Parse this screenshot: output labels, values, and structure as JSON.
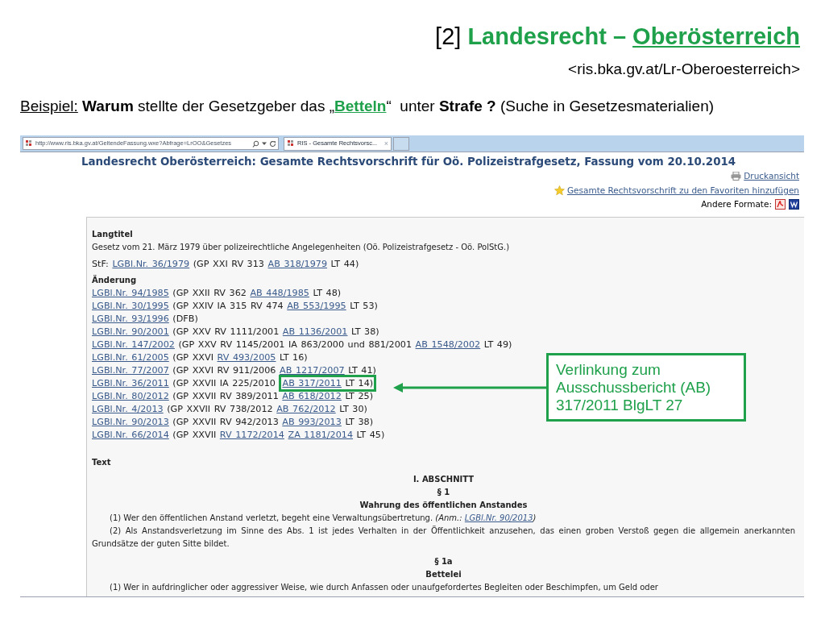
{
  "slide": {
    "heading": [
      {
        "text": "[2] ",
        "kind": "plain"
      },
      {
        "text": "Landesrecht – ",
        "kind": "accent"
      },
      {
        "text": "Oberösterreich",
        "kind": "accent_underline"
      }
    ],
    "subtitle": "<ris.bka.gv.at/Lr-Oberoesterreich>",
    "example": [
      {
        "text": "Beispiel:",
        "kind": "underline"
      },
      {
        "text": " Warum",
        "kind": "bold"
      },
      {
        "text": " stellte der Gesetzgeber das „",
        "kind": "plain"
      },
      {
        "text": "Betteln",
        "kind": "accent_underline"
      },
      {
        "text": "“  unter ",
        "kind": "plain"
      },
      {
        "text": "Strafe ?",
        "kind": "bold"
      },
      {
        "text": " (Suche in Gesetzesmaterialien)",
        "kind": "plain"
      }
    ]
  },
  "browser": {
    "address": "http://www.ris.bka.gv.at/GeltendeFassung.wxe?Abfrage=LrOO&Gesetzes",
    "tab": {
      "title": "RIS - Gesamte Rechtsvorsc...",
      "close": "×"
    }
  },
  "page": {
    "title": "Landesrecht Oberösterreich: Gesamte Rechtsvorschrift für Oö. Polizeistrafgesetz, Fassung vom 20.10.2014",
    "links": [
      {
        "kind": "print",
        "text": "Druckansicht"
      },
      {
        "kind": "favorite",
        "text": "Gesamte Rechtsvorschrift zu den Favoriten hinzufügen"
      }
    ],
    "formats": {
      "label": "Andere Formate:",
      "items": [
        {
          "kind": "pdf"
        },
        {
          "kind": "word"
        }
      ]
    },
    "document": {
      "langtitel": {
        "heading": "Langtitel",
        "text": "Gesetz vom 21. März 1979 über polizeirechtliche Angelegenheiten (Oö. Polizeistrafgesetz - Oö. PolStG.)"
      },
      "stf": [
        {
          "text": "StF: ",
          "link": false
        },
        {
          "text": "LGBl.Nr. 36/1979",
          "link": true
        },
        {
          "text": " (GP XXI RV 313 ",
          "link": false
        },
        {
          "text": "AB 318/1979",
          "link": true
        },
        {
          "text": " LT 44)",
          "link": false
        }
      ],
      "changes": {
        "heading": "Änderung",
        "rows": [
          {
            "parts": [
              {
                "text": "LGBl.Nr. 94/1985",
                "link": true
              },
              {
                "text": " (GP XXII RV 362 ",
                "link": false
              },
              {
                "text": "AB 448/1985",
                "link": true
              },
              {
                "text": " LT 48)",
                "link": false
              }
            ]
          },
          {
            "parts": [
              {
                "text": "LGBl.Nr. 30/1995",
                "link": true
              },
              {
                "text": " (GP XXIV IA 315 RV 474 ",
                "link": false
              },
              {
                "text": "AB 553/1995",
                "link": true
              },
              {
                "text": " LT 53)",
                "link": false
              }
            ]
          },
          {
            "parts": [
              {
                "text": "LGBl.Nr. 93/1996",
                "link": true
              },
              {
                "text": " (DFB)",
                "link": false
              }
            ]
          },
          {
            "parts": [
              {
                "text": "LGBl.Nr. 90/2001",
                "link": true
              },
              {
                "text": " (GP XXV RV 1111/2001 ",
                "link": false
              },
              {
                "text": "AB 1136/2001",
                "link": true
              },
              {
                "text": " LT 38)",
                "link": false
              }
            ]
          },
          {
            "parts": [
              {
                "text": "LGBl.Nr. 147/2002",
                "link": true
              },
              {
                "text": " (GP XXV RV 1145/2001 IA 863/2000 und 881/2001 ",
                "link": false
              },
              {
                "text": "AB 1548/2002",
                "link": true
              },
              {
                "text": " LT 49)",
                "link": false
              }
            ]
          },
          {
            "parts": [
              {
                "text": "LGBl.Nr. 61/2005",
                "link": true
              },
              {
                "text": " (GP XXVI ",
                "link": false
              },
              {
                "text": "RV 493/2005",
                "link": true
              },
              {
                "text": " LT 16)",
                "link": false
              }
            ]
          },
          {
            "parts": [
              {
                "text": "LGBl.Nr. 77/2007",
                "link": true
              },
              {
                "text": " (GP XXVI RV 911/2006 ",
                "link": false
              },
              {
                "text": "AB 1217/2007",
                "link": true
              },
              {
                "text": " LT 41)",
                "link": false
              }
            ]
          },
          {
            "parts": [
              {
                "text": "LGBl.Nr. 36/2011",
                "link": true
              },
              {
                "text": " (GP XXVII IA 225/2010 ",
                "link": false
              }
            ],
            "boxed_parts": [
              {
                "text": "AB 317/2011",
                "link": true
              },
              {
                "text": " LT 14)",
                "link": false
              }
            ]
          },
          {
            "parts": [
              {
                "text": "LGBl.Nr. 80/2012",
                "link": true
              },
              {
                "text": " (GP XXVII RV 389/2011 ",
                "link": false
              },
              {
                "text": "AB 618/2012",
                "link": true
              },
              {
                "text": " LT 25)",
                "link": false
              }
            ]
          },
          {
            "parts": [
              {
                "text": "LGBl.Nr. 4/2013",
                "link": true
              },
              {
                "text": " (GP XXVII RV 738/2012 ",
                "link": false
              },
              {
                "text": "AB 762/2012",
                "link": true
              },
              {
                "text": " LT 30)",
                "link": false
              }
            ]
          },
          {
            "parts": [
              {
                "text": "LGBl.Nr. 90/2013",
                "link": true
              },
              {
                "text": " (GP XXVII RV 942/2013 ",
                "link": false
              },
              {
                "text": "AB 993/2013",
                "link": true
              },
              {
                "text": " LT 38)",
                "link": false
              }
            ]
          },
          {
            "parts": [
              {
                "text": "LGBl.Nr. 66/2014",
                "link": true
              },
              {
                "text": " (GP XXVII ",
                "link": false
              },
              {
                "text": "RV 1172/2014",
                "link": true
              },
              {
                "text": "ZA 1181/2014",
                "link": true
              },
              {
                "text": " LT 45)",
                "link": false
              }
            ]
          }
        ]
      },
      "text": {
        "heading": "Text",
        "blocks": [
          {
            "kind": "center",
            "text": "I. ABSCHNITT"
          },
          {
            "kind": "center",
            "text": "§ 1"
          },
          {
            "kind": "center",
            "text": "Wahrung des öffentlichen Anstandes"
          },
          {
            "kind": "para",
            "parts": [
              {
                "text": "(1) Wer den öffentlichen Anstand verletzt, begeht eine Verwaltungsübertretung. ",
                "kind": "plain"
              },
              {
                "text": "(Anm.: ",
                "kind": "italic"
              },
              {
                "text": "LGBl.Nr. 90/2013",
                "kind": "link"
              },
              {
                "text": ")",
                "kind": "italic"
              }
            ]
          },
          {
            "kind": "para",
            "parts": [
              {
                "text": "(2) Als Anstandsverletzung im Sinne des Abs. 1 ist jedes Verhalten in der Öffentlichkeit anzusehen, das einen groben Verstoß gegen die allgemein anerkannten Grundsätze der guten Sitte bildet.",
                "kind": "plain"
              }
            ]
          },
          {
            "kind": "gap"
          },
          {
            "kind": "center",
            "text": "§ 1a"
          },
          {
            "kind": "center",
            "text": "Bettelei"
          },
          {
            "kind": "para",
            "parts": [
              {
                "text": "(1) Wer in aufdringlicher oder aggressiver Weise, wie durch Anfassen oder unaufgefordertes Begleiten oder Beschimpfen, um Geld oder",
                "kind": "plain"
              }
            ]
          }
        ]
      }
    }
  },
  "callout": {
    "text": "Verlinkung zum Ausschussbericht (AB) 317/2011 BlgLT 27"
  }
}
